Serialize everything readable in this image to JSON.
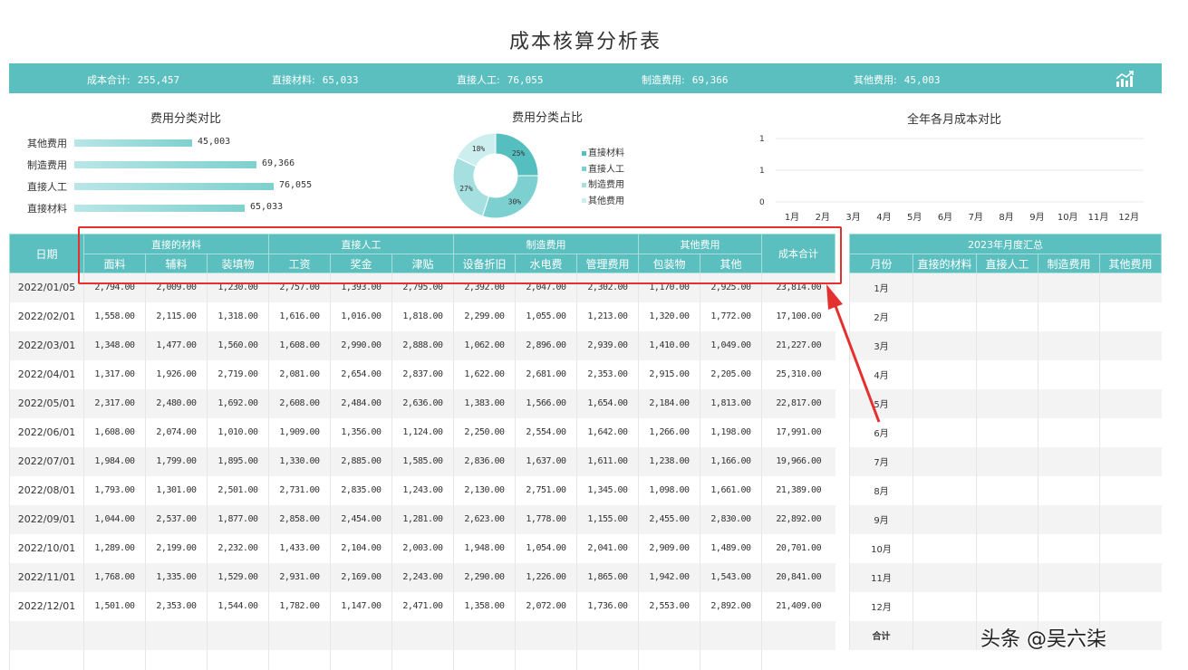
{
  "title": "成本核算分析表",
  "summary": {
    "items": [
      {
        "label": "成本合计:",
        "value": "255,457"
      },
      {
        "label": "直接材料:",
        "value": "65,033"
      },
      {
        "label": "直接人工:",
        "value": "76,055"
      },
      {
        "label": "制造费用:",
        "value": "69,366"
      },
      {
        "label": "其他费用:",
        "value": "45,003"
      }
    ],
    "icon": "trend-chart-icon"
  },
  "panels": {
    "bar_title": "费用分类对比",
    "pie_title": "费用分类占比",
    "line_title": "全年各月成本对比"
  },
  "chart_data": [
    {
      "type": "bar",
      "orientation": "horizontal",
      "title": "费用分类对比",
      "categories": [
        "其他费用",
        "制造费用",
        "直接人工",
        "直接材料"
      ],
      "values": [
        45003,
        69366,
        76055,
        65033
      ],
      "value_labels": [
        "45,003",
        "69,366",
        "76,055",
        "65,033"
      ]
    },
    {
      "type": "pie",
      "donut": true,
      "title": "费用分类占比",
      "categories": [
        "直接材料",
        "直接人工",
        "制造费用",
        "其他费用"
      ],
      "values": [
        25,
        30,
        27,
        18
      ],
      "value_labels": [
        "25%",
        "30%",
        "27%",
        "18%"
      ],
      "colors": [
        "#55bfbf",
        "#7dd0d0",
        "#a6dfdf",
        "#cdeeee"
      ],
      "legend_position": "right"
    },
    {
      "type": "line",
      "title": "全年各月成本对比",
      "categories": [
        "1月",
        "2月",
        "3月",
        "4月",
        "5月",
        "6月",
        "7月",
        "8月",
        "9月",
        "10月",
        "11月",
        "12月"
      ],
      "series": [],
      "y_ticks": [
        "1",
        "1",
        "0"
      ],
      "grid": true
    }
  ],
  "table": {
    "date_header": "日期",
    "groups": [
      {
        "label": "直接的材料",
        "cols": [
          "面料",
          "辅料",
          "装填物"
        ]
      },
      {
        "label": "直接人工",
        "cols": [
          "工资",
          "奖金",
          "津贴"
        ]
      },
      {
        "label": "制造费用",
        "cols": [
          "设备折旧",
          "水电费",
          "管理费用"
        ]
      },
      {
        "label": "其他费用",
        "cols": [
          "包装物",
          "其他"
        ]
      }
    ],
    "total_header": "成本合计",
    "rows": [
      {
        "date": "2022/01/05",
        "vals": [
          "2,794.00",
          "2,009.00",
          "1,230.00",
          "2,757.00",
          "1,393.00",
          "2,795.00",
          "2,392.00",
          "2,047.00",
          "2,302.00",
          "1,170.00",
          "2,925.00"
        ],
        "total": "23,814.00"
      },
      {
        "date": "2022/02/01",
        "vals": [
          "1,558.00",
          "2,115.00",
          "1,318.00",
          "1,616.00",
          "1,016.00",
          "1,818.00",
          "2,299.00",
          "1,055.00",
          "1,213.00",
          "1,320.00",
          "1,772.00"
        ],
        "total": "17,100.00"
      },
      {
        "date": "2022/03/01",
        "vals": [
          "1,348.00",
          "1,477.00",
          "1,560.00",
          "1,608.00",
          "2,990.00",
          "2,888.00",
          "1,062.00",
          "2,896.00",
          "2,939.00",
          "1,410.00",
          "1,049.00"
        ],
        "total": "21,227.00"
      },
      {
        "date": "2022/04/01",
        "vals": [
          "1,317.00",
          "1,926.00",
          "2,719.00",
          "2,081.00",
          "2,654.00",
          "2,837.00",
          "1,622.00",
          "2,681.00",
          "2,353.00",
          "2,915.00",
          "2,205.00"
        ],
        "total": "25,310.00"
      },
      {
        "date": "2022/05/01",
        "vals": [
          "2,317.00",
          "2,480.00",
          "1,692.00",
          "2,608.00",
          "2,484.00",
          "2,636.00",
          "1,383.00",
          "1,566.00",
          "1,654.00",
          "2,184.00",
          "1,813.00"
        ],
        "total": "22,817.00"
      },
      {
        "date": "2022/06/01",
        "vals": [
          "1,608.00",
          "2,074.00",
          "1,010.00",
          "1,909.00",
          "1,356.00",
          "1,124.00",
          "2,250.00",
          "2,554.00",
          "1,642.00",
          "1,266.00",
          "1,198.00"
        ],
        "total": "17,991.00"
      },
      {
        "date": "2022/07/01",
        "vals": [
          "1,984.00",
          "1,799.00",
          "1,895.00",
          "1,330.00",
          "2,885.00",
          "1,585.00",
          "2,836.00",
          "1,637.00",
          "1,611.00",
          "1,238.00",
          "1,166.00"
        ],
        "total": "19,966.00"
      },
      {
        "date": "2022/08/01",
        "vals": [
          "1,793.00",
          "1,301.00",
          "2,501.00",
          "2,731.00",
          "2,835.00",
          "1,243.00",
          "2,130.00",
          "2,751.00",
          "1,345.00",
          "1,098.00",
          "1,661.00"
        ],
        "total": "21,389.00"
      },
      {
        "date": "2022/09/01",
        "vals": [
          "1,044.00",
          "2,537.00",
          "1,877.00",
          "2,858.00",
          "2,454.00",
          "1,281.00",
          "2,623.00",
          "1,778.00",
          "1,155.00",
          "2,455.00",
          "2,830.00"
        ],
        "total": "22,892.00"
      },
      {
        "date": "2022/10/01",
        "vals": [
          "1,289.00",
          "2,199.00",
          "2,232.00",
          "1,433.00",
          "2,104.00",
          "2,003.00",
          "1,948.00",
          "1,054.00",
          "2,041.00",
          "2,909.00",
          "1,489.00"
        ],
        "total": "20,701.00"
      },
      {
        "date": "2022/11/01",
        "vals": [
          "1,768.00",
          "1,335.00",
          "1,529.00",
          "2,931.00",
          "2,169.00",
          "2,243.00",
          "2,290.00",
          "1,226.00",
          "1,865.00",
          "1,942.00",
          "1,543.00"
        ],
        "total": "20,841.00"
      },
      {
        "date": "2022/12/01",
        "vals": [
          "1,501.00",
          "2,353.00",
          "1,544.00",
          "1,782.00",
          "1,147.00",
          "2,471.00",
          "1,358.00",
          "2,072.00",
          "1,736.00",
          "2,553.00",
          "2,892.00"
        ],
        "total": "21,409.00"
      }
    ],
    "empty_rows": 2
  },
  "side_table": {
    "title": "2023年月度汇总",
    "headers": [
      "月份",
      "直接的材料",
      "直接人工",
      "制造费用",
      "其他费用"
    ],
    "months": [
      "1月",
      "2月",
      "3月",
      "4月",
      "5月",
      "6月",
      "7月",
      "8月",
      "9月",
      "10月",
      "11月",
      "12月"
    ],
    "total_label": "合计"
  },
  "watermark": "头条 @吴六柒"
}
